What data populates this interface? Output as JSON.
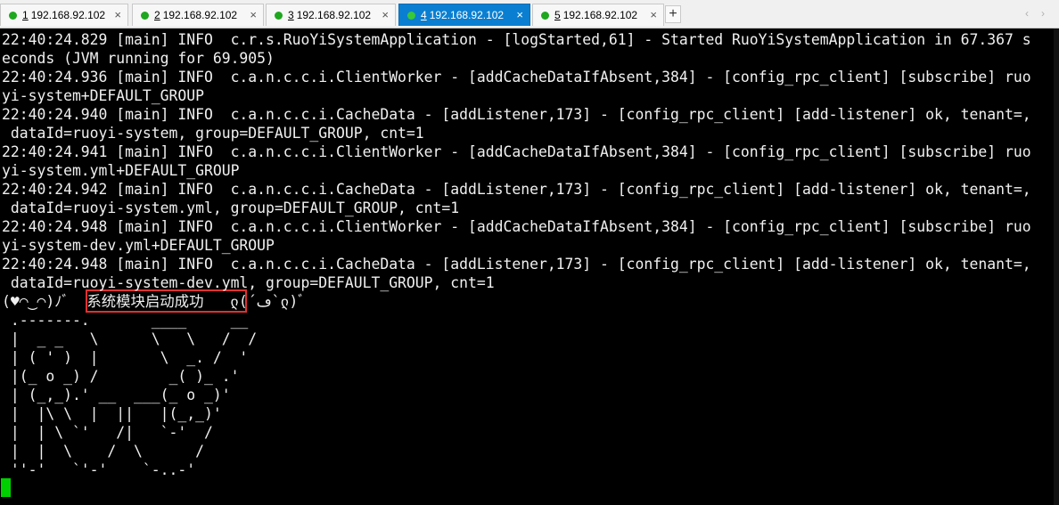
{
  "tabs": [
    {
      "num": "1",
      "host": "192.168.92.102",
      "active": false
    },
    {
      "num": "2",
      "host": "192.168.92.102",
      "active": false
    },
    {
      "num": "3",
      "host": "192.168.92.102",
      "active": false
    },
    {
      "num": "4",
      "host": "192.168.92.102",
      "active": true
    },
    {
      "num": "5",
      "host": "192.168.92.102",
      "active": false
    }
  ],
  "tab_close_glyph": "×",
  "tab_add_glyph": "+",
  "nav_prev_glyph": "‹",
  "nav_next_glyph": "›",
  "colors": {
    "active_tab": "#0a7fd1",
    "status_dot": "#1fa71f",
    "console_bg": "#000000",
    "console_text": "#f0f0f0",
    "cursor": "#00d000",
    "highlight_box": "#e03131"
  },
  "console": {
    "lines": [
      "22:40:24.829 [main] INFO  c.r.s.RuoYiSystemApplication - [logStarted,61] - Started RuoYiSystemApplication in 67.367 s",
      "econds (JVM running for 69.905)",
      "22:40:24.936 [main] INFO  c.a.n.c.c.i.ClientWorker - [addCacheDataIfAbsent,384] - [config_rpc_client] [subscribe] ruo",
      "yi-system+DEFAULT_GROUP",
      "22:40:24.940 [main] INFO  c.a.n.c.c.i.CacheData - [addListener,173] - [config_rpc_client] [add-listener] ok, tenant=,",
      " dataId=ruoyi-system, group=DEFAULT_GROUP, cnt=1",
      "22:40:24.941 [main] INFO  c.a.n.c.c.i.ClientWorker - [addCacheDataIfAbsent,384] - [config_rpc_client] [subscribe] ruo",
      "yi-system.yml+DEFAULT_GROUP",
      "22:40:24.942 [main] INFO  c.a.n.c.c.i.CacheData - [addListener,173] - [config_rpc_client] [add-listener] ok, tenant=,",
      " dataId=ruoyi-system.yml, group=DEFAULT_GROUP, cnt=1",
      "22:40:24.948 [main] INFO  c.a.n.c.c.i.ClientWorker - [addCacheDataIfAbsent,384] - [config_rpc_client] [subscribe] ruo",
      "yi-system-dev.yml+DEFAULT_GROUP",
      "22:40:24.948 [main] INFO  c.a.n.c.c.i.CacheData - [addListener,173] - [config_rpc_client] [add-listener] ok, tenant=,",
      " dataId=ruoyi-system-dev.yml, group=DEFAULT_GROUP, cnt=1",
      "(♥◠‿◠)ﾉﾞ  系统模块启动成功   ლ(´ڡ`ლ)ﾞ",
      " .-------.       ____     __",
      " |  _ _   \\      \\   \\   /  /",
      " | ( ' )  |       \\  _. /  '",
      " |(_ o _) /        _( )_ .'",
      " | (_,_).' __  ___(_ o _)'",
      " |  |\\ \\  |  ||   |(_,_)'",
      " |  | \\ `'   /|   `-'  /",
      " |  |  \\    /  \\      /",
      " ''-'   `'-'    `-..-'"
    ]
  }
}
